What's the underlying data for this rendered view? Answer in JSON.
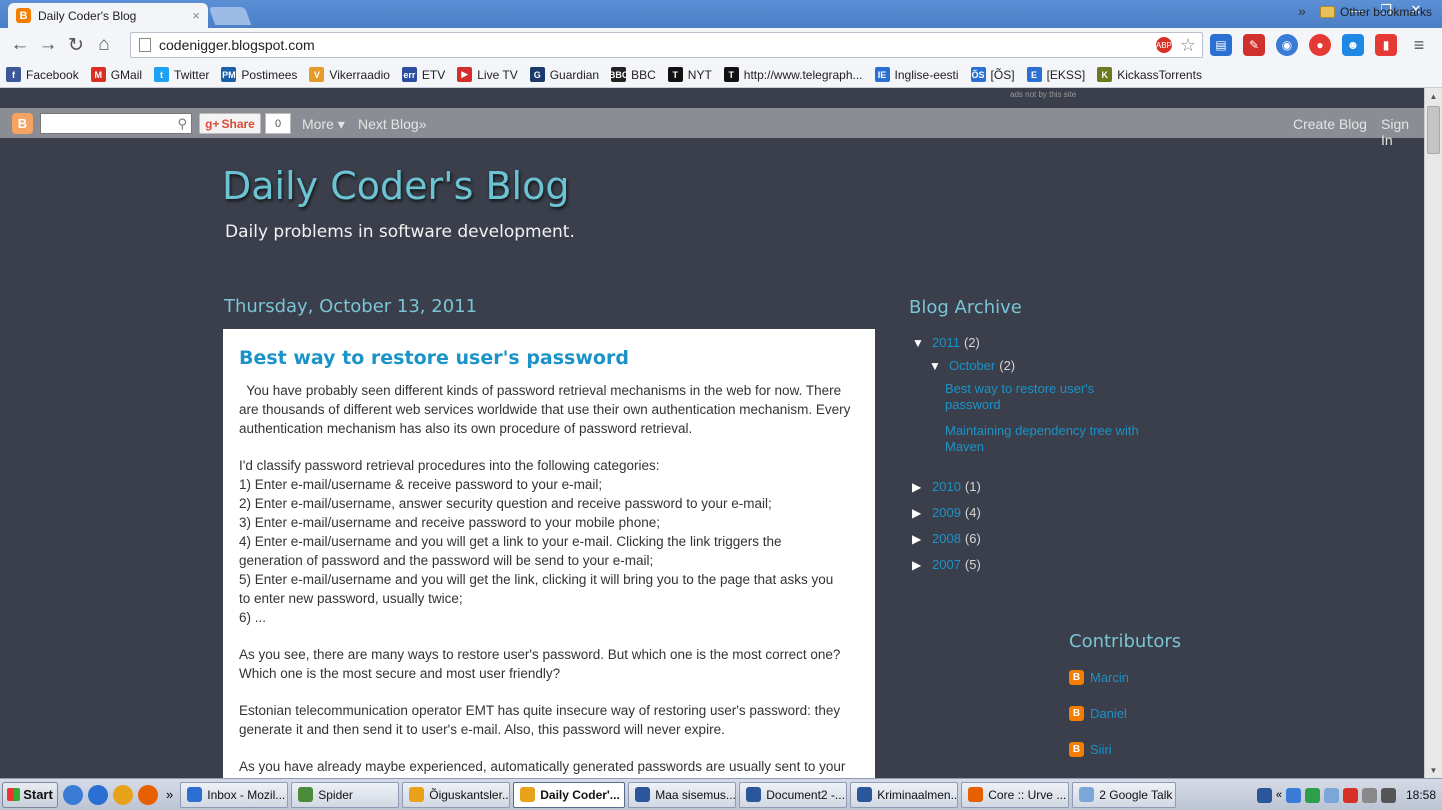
{
  "browser": {
    "tab_title": "Daily Coder's Blog",
    "tab_close": "×",
    "url": "codenigger.blogspot.com",
    "window_controls": [
      "—",
      "❐",
      "✕"
    ]
  },
  "bookmarks": {
    "items": [
      {
        "label": "Facebook",
        "color": "#3b5998",
        "glyph": "f"
      },
      {
        "label": "GMail",
        "color": "#d93025",
        "glyph": "M"
      },
      {
        "label": "Twitter",
        "color": "#1da1f2",
        "glyph": "t"
      },
      {
        "label": "Postimees",
        "color": "#1a5fa8",
        "glyph": "PM"
      },
      {
        "label": "Vikerraadio",
        "color": "#e59b2a",
        "glyph": "V"
      },
      {
        "label": "ETV",
        "color": "#2a4fa0",
        "glyph": "err"
      },
      {
        "label": "Live TV",
        "color": "#d32f2f",
        "glyph": "▶"
      },
      {
        "label": "Guardian",
        "color": "#1b3a6b",
        "glyph": "G"
      },
      {
        "label": "BBC",
        "color": "#222222",
        "glyph": "BBC"
      },
      {
        "label": "NYT",
        "color": "#111111",
        "glyph": "T"
      },
      {
        "label": "http://www.telegraph...",
        "color": "#111111",
        "glyph": "T"
      },
      {
        "label": "Inglise-eesti",
        "color": "#2a6fd1",
        "glyph": "IE"
      },
      {
        "label": "[ÕS]",
        "color": "#2a6fd1",
        "glyph": "ÕS"
      },
      {
        "label": "[EKSS]",
        "color": "#2a6fd1",
        "glyph": "E"
      },
      {
        "label": "KickassTorrents",
        "color": "#6b7a1f",
        "glyph": "K"
      }
    ],
    "chevron": "»",
    "other": "Other bookmarks"
  },
  "blogger_navbar": {
    "ads_note": "ads not by this site",
    "share_label": "Share",
    "share_count": "0",
    "more": "More ▾",
    "next_blog": "Next Blog»",
    "create_blog": "Create Blog",
    "sign_in": "Sign In"
  },
  "blog": {
    "title": "Daily Coder's Blog",
    "description": "Daily problems in software development."
  },
  "post": {
    "date": "Thursday, October 13, 2011",
    "title": "Best way to restore user's password",
    "paragraphs": [
      [
        "  You have probably seen different kinds of password retrieval mechanisms in the web for now. There",
        "are thousands of different web services worldwide that use their own authentication mechanism. Every",
        "authentication mechanism has also its own procedure of password retrieval."
      ],
      [
        "I'd classify password retrieval procedures into the following categories:",
        "1) Enter e-mail/username & receive password to your e-mail;",
        "2) Enter e-mail/username, answer security question and receive password to your e-mail;",
        "3) Enter e-mail/username and receive password to your mobile phone;",
        "4) Enter e-mail/username and you will get a link to your e-mail. Clicking the link triggers the",
        "generation of password and the password will be send to your e-mail;",
        "5) Enter e-mail/username and you will get the link, clicking it will bring you to the page that asks you",
        "to enter new password, usually twice;",
        "6) ..."
      ],
      [
        "As you see, there are many ways to restore user's password. But which one is the most correct one?",
        "Which one is the most secure and most user friendly?"
      ],
      [
        "Estonian telecommunication operator EMT has quite insecure way of restoring user's password: they",
        "generate it and then send it to user's e-mail. Also, this password will never expire."
      ],
      [
        "As you have already maybe experienced, automatically generated passwords are usually sent to your"
      ]
    ]
  },
  "archive": {
    "title": "Blog Archive",
    "year_2011": {
      "year": "2011",
      "count": "(2)"
    },
    "october": {
      "month": "October",
      "count": "(2)"
    },
    "posts": [
      "Best way to restore user's password",
      "Maintaining dependency tree with Maven"
    ],
    "years": [
      {
        "year": "2010",
        "count": "(1)"
      },
      {
        "year": "2009",
        "count": "(4)"
      },
      {
        "year": "2008",
        "count": "(6)"
      },
      {
        "year": "2007",
        "count": "(5)"
      }
    ]
  },
  "contributors": {
    "title": "Contributors",
    "names": [
      "Marcin",
      "Daniel",
      "Siiri"
    ]
  },
  "taskbar": {
    "start": "Start",
    "chevron": "»",
    "tasks": [
      {
        "label": "Inbox - Mozil...",
        "color": "#2a6fd1",
        "active": false
      },
      {
        "label": "Spider",
        "color": "#4a8a3a",
        "active": false
      },
      {
        "label": "Õiguskantsler...",
        "color": "#e8a21a",
        "active": false
      },
      {
        "label": "Daily Coder'...",
        "color": "#e8a21a",
        "active": true
      },
      {
        "label": "Maa sisemus....",
        "color": "#2b579a",
        "active": false
      },
      {
        "label": "Document2 -...",
        "color": "#2b579a",
        "active": false
      },
      {
        "label": "Kriminaalmen...",
        "color": "#2b579a",
        "active": false
      },
      {
        "label": "Core :: Urve ...",
        "color": "#e66000",
        "active": false
      },
      {
        "label": "2 Google Talk",
        "color": "#7aa7d8",
        "active": false
      }
    ],
    "clock": "18:58"
  }
}
